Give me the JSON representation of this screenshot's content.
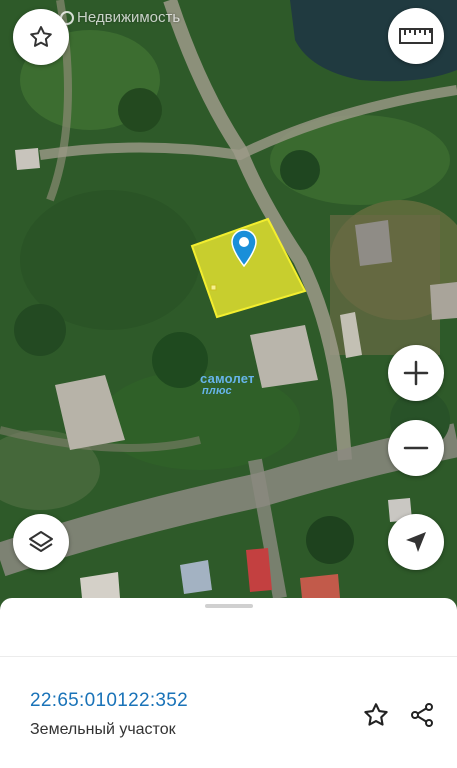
{
  "brand": {
    "text": "Недвижимость",
    "icon": "cian-logo-icon"
  },
  "map": {
    "watermark_line1": "самолет",
    "watermark_line2": "плюс",
    "plot_color": "#f3ee2f",
    "marker_color": "#1a8fd9"
  },
  "controls": {
    "favorite_icon": "star-outline-icon",
    "ruler_icon": "ruler-icon",
    "zoom_in_icon": "plus-icon",
    "zoom_out_icon": "minus-icon",
    "layers_icon": "layers-icon",
    "locate_icon": "navigation-arrow-icon"
  },
  "sheet": {
    "cadastral_number": "22:65:010122:352",
    "object_type": "Земельный участок",
    "favorite_icon": "star-outline-icon",
    "share_icon": "share-icon",
    "accent": "#1a73b8"
  }
}
